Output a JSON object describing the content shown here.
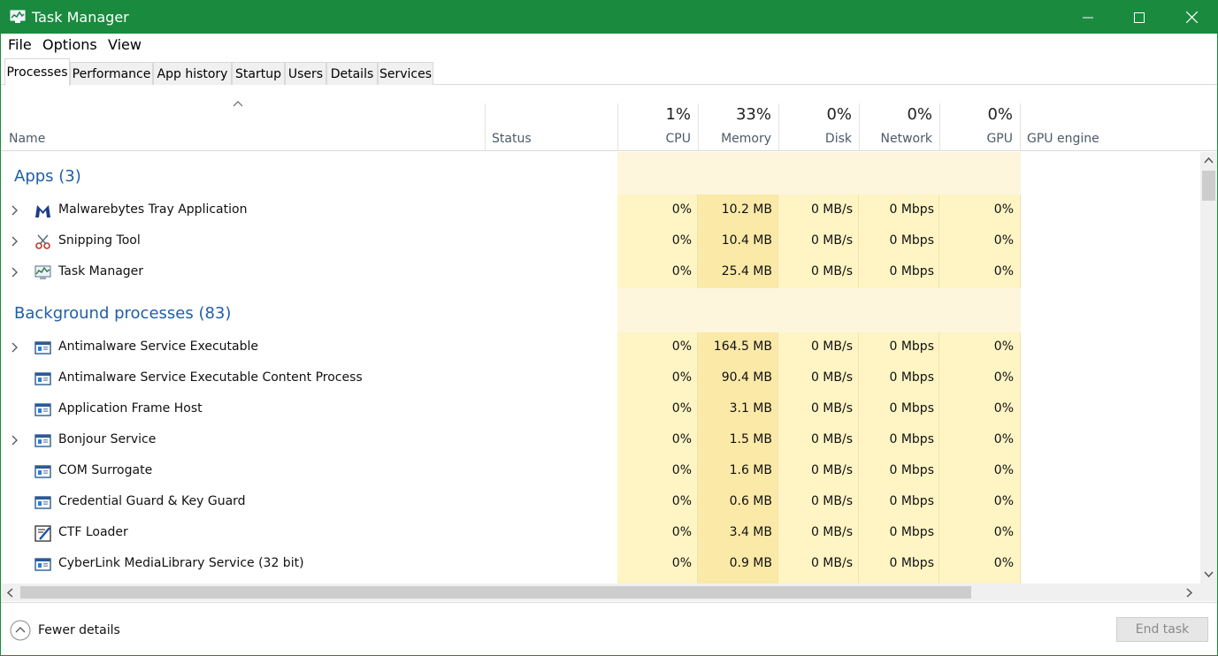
{
  "window": {
    "title": "Task Manager",
    "accent_color": "#1a8a3e",
    "group_color": "#1f5fa8",
    "heat_light": "#fdf5dc",
    "heat_medium": "#fff2c4",
    "heat_dark": "#f9e7a6"
  },
  "menu": [
    "File",
    "Options",
    "View"
  ],
  "tabs": [
    "Processes",
    "Performance",
    "App history",
    "Startup",
    "Users",
    "Details",
    "Services"
  ],
  "header": {
    "name": "Name",
    "status": "Status",
    "cpu_pct": "1%",
    "cpu": "CPU",
    "memory_pct": "33%",
    "memory": "Memory",
    "disk_pct": "0%",
    "disk": "Disk",
    "network_pct": "0%",
    "network": "Network",
    "gpu_pct": "0%",
    "gpu": "GPU",
    "gpu_engine": "GPU engine"
  },
  "groups": {
    "apps": "Apps (3)",
    "background": "Background processes (83)"
  },
  "apps": [
    {
      "name": "Malwarebytes Tray Application",
      "icon": "malwarebytes-icon",
      "expandable": true,
      "cpu": "0%",
      "memory": "10.2 MB",
      "disk": "0 MB/s",
      "network": "0 Mbps",
      "gpu": "0%"
    },
    {
      "name": "Snipping Tool",
      "icon": "scissors-icon",
      "expandable": true,
      "cpu": "0%",
      "memory": "10.4 MB",
      "disk": "0 MB/s",
      "network": "0 Mbps",
      "gpu": "0%"
    },
    {
      "name": "Task Manager",
      "icon": "task-manager-icon",
      "expandable": true,
      "cpu": "0%",
      "memory": "25.4 MB",
      "disk": "0 MB/s",
      "network": "0 Mbps",
      "gpu": "0%"
    }
  ],
  "background": [
    {
      "name": "Antimalware Service Executable",
      "icon": "service-window-icon",
      "expandable": true,
      "cpu": "0%",
      "memory": "164.5 MB",
      "disk": "0 MB/s",
      "network": "0 Mbps",
      "gpu": "0%"
    },
    {
      "name": "Antimalware Service Executable Content Process",
      "icon": "service-window-icon",
      "expandable": false,
      "cpu": "0%",
      "memory": "90.4 MB",
      "disk": "0 MB/s",
      "network": "0 Mbps",
      "gpu": "0%"
    },
    {
      "name": "Application Frame Host",
      "icon": "service-window-icon",
      "expandable": false,
      "cpu": "0%",
      "memory": "3.1 MB",
      "disk": "0 MB/s",
      "network": "0 Mbps",
      "gpu": "0%"
    },
    {
      "name": "Bonjour Service",
      "icon": "service-window-icon",
      "expandable": true,
      "cpu": "0%",
      "memory": "1.5 MB",
      "disk": "0 MB/s",
      "network": "0 Mbps",
      "gpu": "0%"
    },
    {
      "name": "COM Surrogate",
      "icon": "service-window-icon",
      "expandable": false,
      "cpu": "0%",
      "memory": "1.6 MB",
      "disk": "0 MB/s",
      "network": "0 Mbps",
      "gpu": "0%"
    },
    {
      "name": "Credential Guard & Key Guard",
      "icon": "service-window-icon",
      "expandable": false,
      "cpu": "0%",
      "memory": "0.6 MB",
      "disk": "0 MB/s",
      "network": "0 Mbps",
      "gpu": "0%"
    },
    {
      "name": "CTF Loader",
      "icon": "ctf-loader-icon",
      "expandable": false,
      "cpu": "0%",
      "memory": "3.4 MB",
      "disk": "0 MB/s",
      "network": "0 Mbps",
      "gpu": "0%"
    },
    {
      "name": "CyberLink MediaLibrary Service (32 bit)",
      "icon": "service-window-icon",
      "expandable": false,
      "cpu": "0%",
      "memory": "0.9 MB",
      "disk": "0 MB/s",
      "network": "0 Mbps",
      "gpu": "0%"
    }
  ],
  "footer": {
    "fewer_details": "Fewer details",
    "end_task": "End task"
  }
}
